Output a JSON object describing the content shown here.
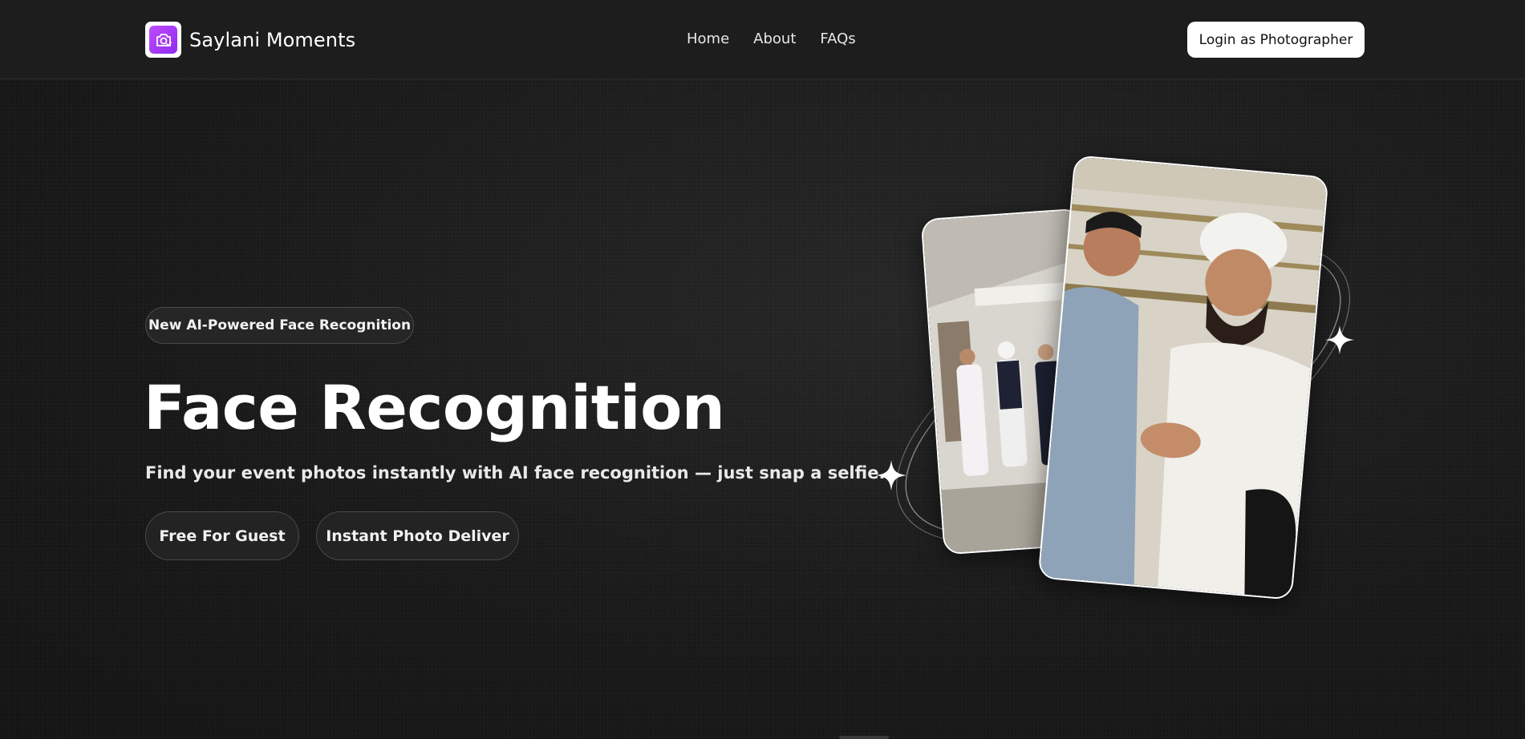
{
  "header": {
    "brand_name": "Saylani Moments",
    "nav": [
      "Home",
      "About",
      "FAQs"
    ],
    "login_label": "Login as Photographer"
  },
  "hero": {
    "badge": "New AI-Powered Face Recognition",
    "title": "Face Recognition",
    "subtitle": "Find your event photos instantly with AI face recognition — just snap a selfie.",
    "buttons": [
      "Free For Guest",
      "Instant Photo Deliver"
    ]
  },
  "icons": {
    "logo": "camera-icon",
    "sparkles": [
      "sparkle-icon",
      "sparkle-icon"
    ]
  },
  "colors": {
    "background": "#161616",
    "header": "#1d1d1d",
    "brand_gradient_start": "#c04bff",
    "brand_gradient_end": "#8f2cf0",
    "login_button": "#ffffff"
  }
}
